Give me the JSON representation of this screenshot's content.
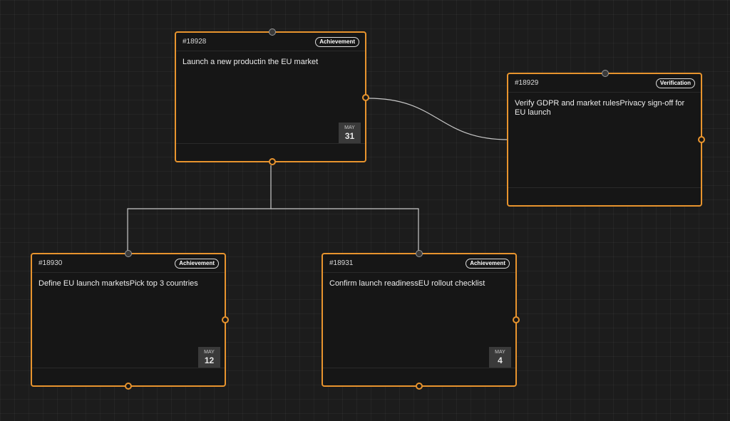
{
  "nodes": {
    "n18928": {
      "id": "#18928",
      "badge": "Achievement",
      "text": "Launch a new productin the EU market",
      "date": {
        "month": "MAY",
        "day": "31"
      }
    },
    "n18929": {
      "id": "#18929",
      "badge": "Verification",
      "text": "Verify GDPR and market rulesPrivacy sign-off for EU launch"
    },
    "n18930": {
      "id": "#18930",
      "badge": "Achievement",
      "text": "Define EU launch marketsPick top 3 countries",
      "date": {
        "month": "MAY",
        "day": "12"
      }
    },
    "n18931": {
      "id": "#18931",
      "badge": "Achievement",
      "text": "Confirm launch readinessEU rollout checklist",
      "date": {
        "month": "MAY",
        "day": "4"
      }
    }
  },
  "colors": {
    "node_border": "#e8942e",
    "edge": "#c8c8c8",
    "background": "#1c1c1c"
  }
}
